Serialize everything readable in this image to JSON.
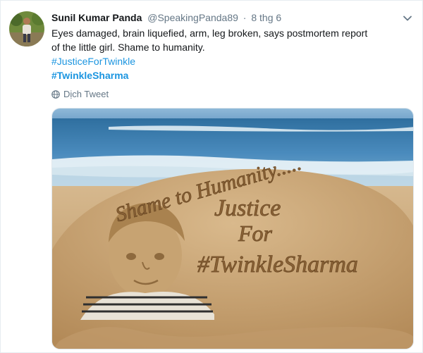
{
  "tweet": {
    "display_name": "Sunil Kumar Panda",
    "handle": "@SpeakingPanda89",
    "separator": "·",
    "time": "8 thg 6",
    "text_line1": "Eyes damaged, brain liquefied, arm, leg broken, says postmortem report",
    "text_line2": "of the little girl. Shame to humanity.",
    "hashtags": [
      "#JusticeForTwinkle",
      "#TwinkleSharma"
    ],
    "translate_label": "Dịch Tweet"
  },
  "sculpture_text": {
    "line1": "Shame to Humanity.....",
    "line2": "Justice",
    "line3": "For",
    "line4": "#TwinkleSharma"
  },
  "icons": {
    "caret": "chevron-down-icon",
    "translate": "globe-icon"
  },
  "colors": {
    "link": "#1b95e0",
    "text": "#14171a",
    "muted": "#657786",
    "sand": "#c9a678",
    "sea": "#4a8bbd"
  }
}
